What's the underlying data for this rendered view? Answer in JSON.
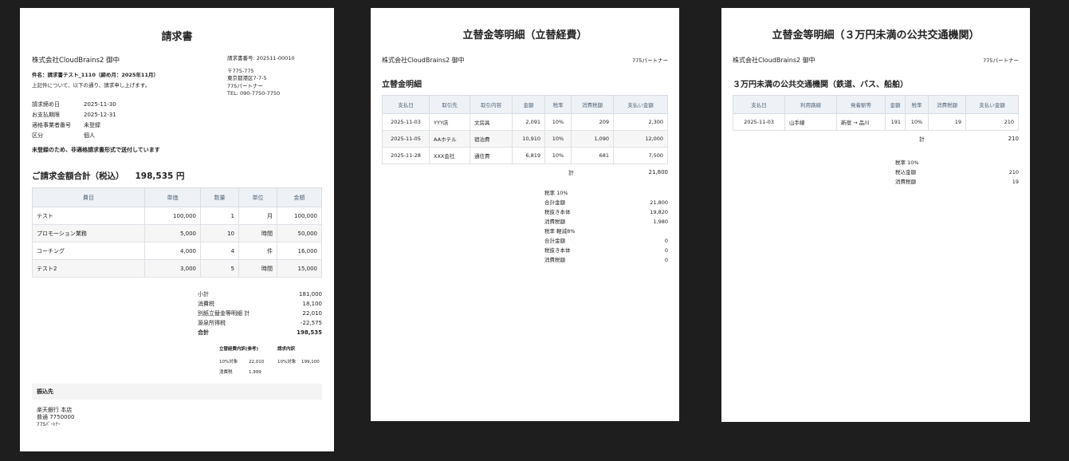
{
  "invoice": {
    "title": "請求書",
    "client": "株式会社CloudBrains2 御中",
    "subject": "件名：請求書テスト_1110（締め月：2025年11月）",
    "intro": "上記件について、以下の通り、請求申し上げます。",
    "info": [
      {
        "k": "請求締め日",
        "v": "2025-11-30"
      },
      {
        "k": "お支払期限",
        "v": "2025-12-31"
      },
      {
        "k": "適格事業者番号",
        "v": "未登録"
      },
      {
        "k": "区分",
        "v": "個人"
      }
    ],
    "notice": "未登録のため、非適格請求書形式で送付しています",
    "issuer": {
      "number": "請求書番号: 202511-00010",
      "postal": "〒775-775",
      "address": "東京都港区7-7-5",
      "name": "775パートナー",
      "tel": "TEL: 090-7750-7750"
    },
    "total_label": "ご請求金額合計（税込）",
    "total_value": "198,535 円",
    "table": {
      "headers": [
        "費目",
        "単価",
        "数量",
        "単位",
        "金額"
      ],
      "rows": [
        [
          "テスト",
          "100,000",
          "1",
          "月",
          "100,000"
        ],
        [
          "プロモーション業務",
          "5,000",
          "10",
          "時間",
          "50,000"
        ],
        [
          "コーチング",
          "4,000",
          "4",
          "件",
          "16,000"
        ],
        [
          "テスト2",
          "3,000",
          "5",
          "時間",
          "15,000"
        ]
      ]
    },
    "summary": [
      {
        "k": "小計",
        "v": "181,000"
      },
      {
        "k": "消費税",
        "v": "18,100"
      },
      {
        "k": "別紙立替金等明細 計",
        "v": "22,010"
      },
      {
        "k": "源泉所得税",
        "v": "-22,575"
      },
      {
        "k": "合計",
        "v": "198,535"
      }
    ],
    "breakdown": {
      "ref_title": "立替経費内訳(参考)",
      "ref_rows": [
        {
          "k": "10%対象",
          "v": "22,010"
        },
        {
          "k": "消費税",
          "v": "1,999"
        }
      ],
      "inv_title": "請求内訳",
      "inv_rows": [
        {
          "k": "10%対象",
          "v": "199,100"
        }
      ]
    },
    "bank_title": "振込先",
    "bank_lines": [
      "楽天銀行 本店",
      "普通 7750000",
      "775ﾊﾟｰﾄﾅｰ"
    ]
  },
  "expenses": {
    "title": "立替金等明細（立替経費）",
    "client": "株式会社CloudBrains2 御中",
    "partner": "775パートナー",
    "section": "立替金明細",
    "headers": [
      "支払日",
      "取引先",
      "取引内容",
      "金額",
      "税率",
      "消費税額",
      "支払い金額"
    ],
    "rows": [
      [
        "2025-11-03",
        "YYY店",
        "文房具",
        "2,091",
        "10%",
        "209",
        "2,300"
      ],
      [
        "2025-11-05",
        "AAホテル",
        "宿泊費",
        "10,910",
        "10%",
        "1,090",
        "12,000"
      ],
      [
        "2025-11-28",
        "XXX会社",
        "通信費",
        "6,819",
        "10%",
        "681",
        "7,500"
      ]
    ],
    "total_label": "計",
    "total_value": "21,800",
    "tax_rows": [
      {
        "k": "税率 10%",
        "v": ""
      },
      {
        "k": "合計金額",
        "v": "21,800"
      },
      {
        "k": "税抜き本体",
        "v": "19,820"
      },
      {
        "k": "消費税額",
        "v": "1,980"
      },
      {
        "k": "税率 軽減8%",
        "v": ""
      },
      {
        "k": "合計金額",
        "v": "0"
      },
      {
        "k": "税抜き本体",
        "v": "0"
      },
      {
        "k": "消費税額",
        "v": "0"
      }
    ]
  },
  "transit": {
    "title": "立替金等明細（３万円未満の公共交通機関）",
    "client": "株式会社CloudBrains2 御中",
    "partner": "775パートナー",
    "section": "３万円未満の公共交通機関（鉄道、バス、船舶）",
    "headers": [
      "支払日",
      "利用路線",
      "発着駅等",
      "金額",
      "税率",
      "消費税額",
      "支払い金額"
    ],
    "rows": [
      [
        "2025-11-03",
        "山手線",
        "新宿 → 品川",
        "191",
        "10%",
        "19",
        "210"
      ]
    ],
    "total_label": "計",
    "total_value": "210",
    "tax_rows": [
      {
        "k": "税率 10%",
        "v": ""
      },
      {
        "k": "税込金額",
        "v": "210"
      },
      {
        "k": "消費税額",
        "v": "19"
      }
    ]
  }
}
